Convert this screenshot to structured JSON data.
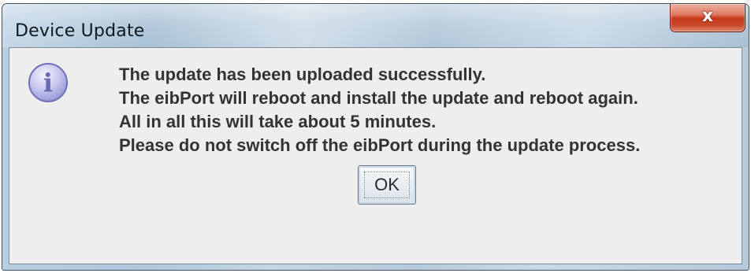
{
  "window": {
    "title": "Device Update",
    "close_symbol": "x"
  },
  "dialog": {
    "icon": "info-icon",
    "icon_glyph": "i",
    "message_lines": [
      "The update has been uploaded successfully.",
      "The eibPort will reboot and install the update and reboot again.",
      "All in all this will take about 5 minutes.",
      "Please do not switch off the eibPort during the update process."
    ],
    "ok_label": "OK"
  },
  "colors": {
    "close_button": "#c7391c",
    "text": "#333333",
    "dialog_background": "#eeeeee",
    "info_icon": "#a9a9e0"
  }
}
